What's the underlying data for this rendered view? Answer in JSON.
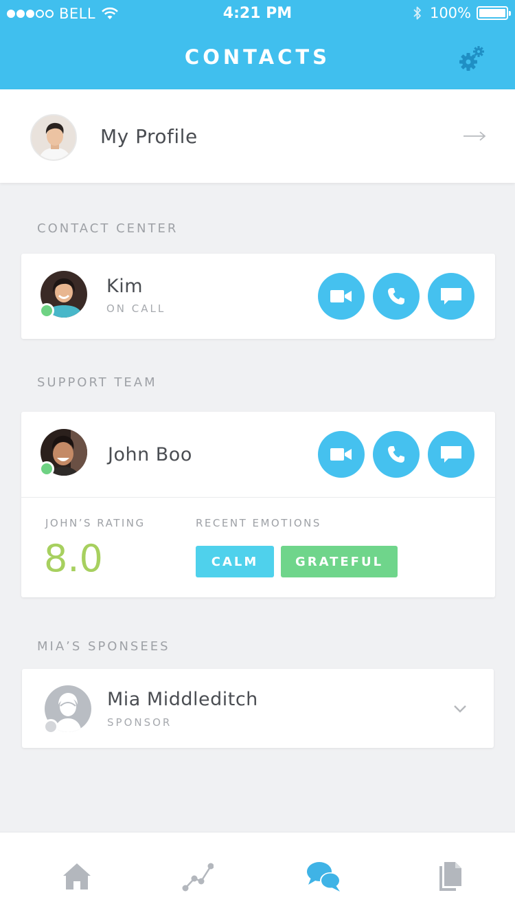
{
  "status_bar": {
    "carrier": "BELL",
    "time": "4:21 PM",
    "battery": "100%"
  },
  "header": {
    "title": "CONTACTS",
    "settings_icon": "gear-icon"
  },
  "profile": {
    "label": "My Profile",
    "arrow_icon": "arrow-right-icon"
  },
  "sections": {
    "contact_center": "CONTACT CENTER",
    "support_team": "SUPPORT TEAM",
    "sponsees": "MIA’S SPONSEES"
  },
  "contact_center": {
    "name": "Kim",
    "status": "ON CALL",
    "online": true
  },
  "support_team": {
    "name": "John Boo",
    "online": true,
    "rating_label": "JOHN’S RATING",
    "rating_value": "8.0",
    "emotions_label": "RECENT EMOTIONS",
    "emotions": [
      {
        "label": "CALM",
        "color": "#4fd1ec"
      },
      {
        "label": "GRATEFUL",
        "color": "#6fd58b"
      }
    ]
  },
  "sponsee": {
    "name": "Mia Middleditch",
    "role": "SPONSOR",
    "online": false
  },
  "actions": [
    "video-icon",
    "phone-icon",
    "chat-icon"
  ],
  "tab_bar": {
    "items": [
      "home-icon",
      "stats-icon",
      "chat-bubbles-icon",
      "documents-icon"
    ],
    "active": "chat-bubbles-icon"
  },
  "colors": {
    "header": "#40bfee",
    "accent": "#45c1ef",
    "online": "#6ed283",
    "rating": "#a7d05f",
    "background": "#f0f1f3"
  }
}
